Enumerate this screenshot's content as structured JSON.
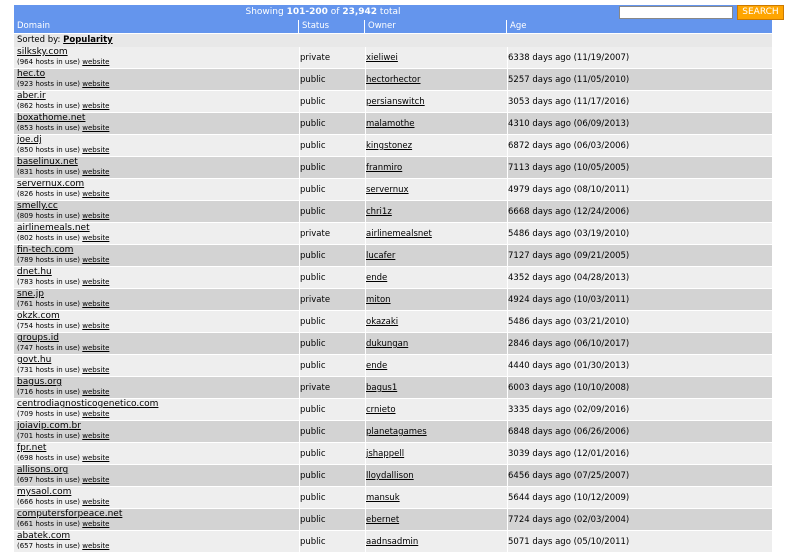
{
  "summary": {
    "prefix": "Showing",
    "range": "101-200",
    "of": "of",
    "total": "23,942",
    "suffix": "total"
  },
  "search": {
    "value": "",
    "placeholder": "",
    "button_label": "SEARCH"
  },
  "columns": {
    "domain": "Domain",
    "status": "Status",
    "owner": "Owner",
    "age": "Age"
  },
  "sorted": {
    "label": "Sorted by:",
    "value": "Popularity"
  },
  "website_label": "website",
  "colors": {
    "header_bg": "#6495ed",
    "search_button": "#ffa500",
    "row_light": "#eeeeee",
    "row_dark": "#d3d3d3"
  },
  "rows": [
    {
      "domain": "silksky.com",
      "hosts": "(964 hosts in use)",
      "status": "private",
      "owner": "xieliwei",
      "age": "6338 days ago (11/19/2007)"
    },
    {
      "domain": "hec.to",
      "hosts": "(923 hosts in use)",
      "status": "public",
      "owner": "hectorhector",
      "age": "5257 days ago (11/05/2010)"
    },
    {
      "domain": "aber.ir",
      "hosts": "(862 hosts in use)",
      "status": "public",
      "owner": "persianswitch",
      "age": "3053 days ago (11/17/2016)"
    },
    {
      "domain": "boxathome.net",
      "hosts": "(853 hosts in use)",
      "status": "public",
      "owner": "malamothe",
      "age": "4310 days ago (06/09/2013)"
    },
    {
      "domain": "joe.dj",
      "hosts": "(850 hosts in use)",
      "status": "public",
      "owner": "kingstonez",
      "age": "6872 days ago (06/03/2006)"
    },
    {
      "domain": "baselinux.net",
      "hosts": "(831 hosts in use)",
      "status": "public",
      "owner": "franmiro",
      "age": "7113 days ago (10/05/2005)"
    },
    {
      "domain": "servernux.com",
      "hosts": "(826 hosts in use)",
      "status": "public",
      "owner": "servernux",
      "age": "4979 days ago (08/10/2011)"
    },
    {
      "domain": "smelly.cc",
      "hosts": "(809 hosts in use)",
      "status": "public",
      "owner": "chri1z",
      "age": "6668 days ago (12/24/2006)"
    },
    {
      "domain": "airlinemeals.net",
      "hosts": "(802 hosts in use)",
      "status": "private",
      "owner": "airlinemealsnet",
      "age": "5486 days ago (03/19/2010)"
    },
    {
      "domain": "fin-tech.com",
      "hosts": "(789 hosts in use)",
      "status": "public",
      "owner": "lucafer",
      "age": "7127 days ago (09/21/2005)"
    },
    {
      "domain": "dnet.hu",
      "hosts": "(783 hosts in use)",
      "status": "public",
      "owner": "ende",
      "age": "4352 days ago (04/28/2013)"
    },
    {
      "domain": "sne.jp",
      "hosts": "(761 hosts in use)",
      "status": "private",
      "owner": "miton",
      "age": "4924 days ago (10/03/2011)"
    },
    {
      "domain": "okzk.com",
      "hosts": "(754 hosts in use)",
      "status": "public",
      "owner": "okazaki",
      "age": "5486 days ago (03/21/2010)"
    },
    {
      "domain": "groups.id",
      "hosts": "(747 hosts in use)",
      "status": "public",
      "owner": "dukungan",
      "age": "2846 days ago (06/10/2017)"
    },
    {
      "domain": "govt.hu",
      "hosts": "(731 hosts in use)",
      "status": "public",
      "owner": "ende",
      "age": "4440 days ago (01/30/2013)"
    },
    {
      "domain": "bagus.org",
      "hosts": "(716 hosts in use)",
      "status": "private",
      "owner": "bagus1",
      "age": "6003 days ago (10/10/2008)"
    },
    {
      "domain": "centrodiagnosticogenetico.com",
      "hosts": "(709 hosts in use)",
      "status": "public",
      "owner": "crnieto",
      "age": "3335 days ago (02/09/2016)"
    },
    {
      "domain": "joiavip.com.br",
      "hosts": "(701 hosts in use)",
      "status": "public",
      "owner": "planetagames",
      "age": "6848 days ago (06/26/2006)"
    },
    {
      "domain": "fpr.net",
      "hosts": "(698 hosts in use)",
      "status": "public",
      "owner": "jshappell",
      "age": "3039 days ago (12/01/2016)"
    },
    {
      "domain": "allisons.org",
      "hosts": "(697 hosts in use)",
      "status": "public",
      "owner": "lloydallison",
      "age": "6456 days ago (07/25/2007)"
    },
    {
      "domain": "mysaol.com",
      "hosts": "(666 hosts in use)",
      "status": "public",
      "owner": "mansuk",
      "age": "5644 days ago (10/12/2009)"
    },
    {
      "domain": "computersforpeace.net",
      "hosts": "(661 hosts in use)",
      "status": "public",
      "owner": "ebernet",
      "age": "7724 days ago (02/03/2004)"
    },
    {
      "domain": "abatek.com",
      "hosts": "(657 hosts in use)",
      "status": "public",
      "owner": "aadnsadmin",
      "age": "5071 days ago (05/10/2011)"
    }
  ]
}
